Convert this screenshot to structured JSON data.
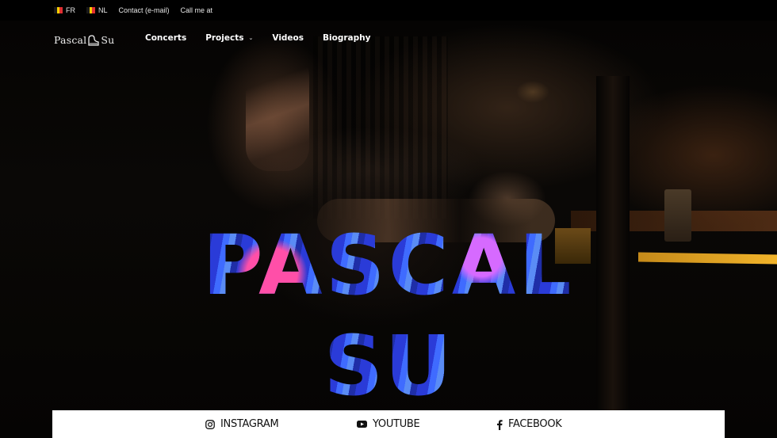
{
  "topbar": {
    "languages": [
      {
        "code": "FR",
        "flag_colors": [
          "#1a1a1a",
          "#f5d000",
          "#e03030"
        ]
      },
      {
        "code": "NL",
        "flag_colors": [
          "#1a1a1a",
          "#f5d000",
          "#e03030"
        ]
      }
    ],
    "contact_label": "Contact (e-mail)",
    "call_label": "Call me at"
  },
  "nav": {
    "logo_left": "Pascal",
    "logo_right": "Su",
    "logo_icon": "grand-piano-icon",
    "items": [
      {
        "label": "Concerts",
        "has_dropdown": false
      },
      {
        "label": "Projects",
        "has_dropdown": true
      },
      {
        "label": "Videos",
        "has_dropdown": false
      },
      {
        "label": "Biography",
        "has_dropdown": false
      }
    ]
  },
  "hero": {
    "title_line1": "PASCAL",
    "title_line2": "SU"
  },
  "social": {
    "links": [
      {
        "label": "INSTAGRAM",
        "icon": "instagram-icon"
      },
      {
        "label": "YOUTUBE",
        "icon": "youtube-icon"
      },
      {
        "label": "FACEBOOK",
        "icon": "facebook-icon"
      }
    ]
  }
}
